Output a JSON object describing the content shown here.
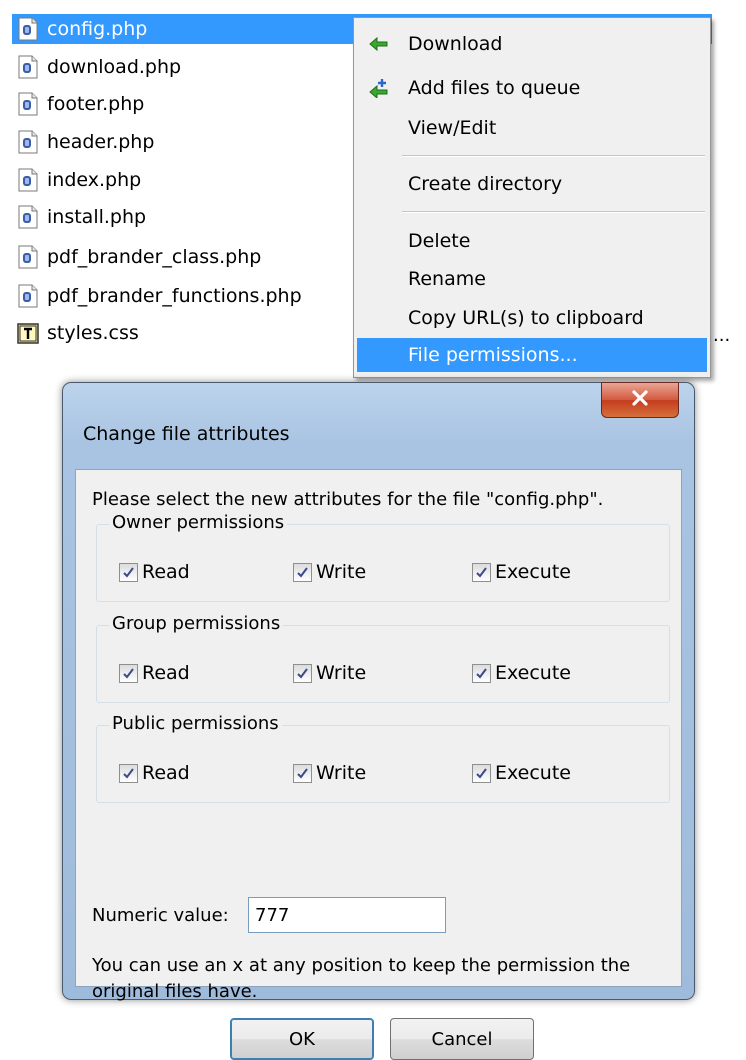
{
  "files": [
    {
      "name": "config.php",
      "icon": "php-file-icon",
      "selected": true
    },
    {
      "name": "download.php",
      "icon": "php-file-icon",
      "selected": false
    },
    {
      "name": "footer.php",
      "icon": "php-file-icon",
      "selected": false
    },
    {
      "name": "header.php",
      "icon": "php-file-icon",
      "selected": false
    },
    {
      "name": "index.php",
      "icon": "php-file-icon",
      "selected": false
    },
    {
      "name": "install.php",
      "icon": "php-file-icon",
      "selected": false
    },
    {
      "name": "pdf_brander_class.php",
      "icon": "php-file-icon",
      "selected": false
    },
    {
      "name": "pdf_brander_functions.php",
      "icon": "php-file-icon",
      "selected": false
    },
    {
      "name": "styles.css",
      "icon": "text-file-icon",
      "selected": false
    }
  ],
  "trailing_dots": "...",
  "context_menu": {
    "items": [
      {
        "label": "Download",
        "icon": "download-arrow-icon"
      },
      {
        "label": "Add files to queue",
        "icon": "add-to-queue-icon"
      },
      {
        "label": "View/Edit"
      },
      {
        "label": "Create directory"
      },
      {
        "label": "Delete"
      },
      {
        "label": "Rename"
      },
      {
        "label": "Copy URL(s) to clipboard"
      },
      {
        "label": "File permissions...",
        "highlighted": true
      }
    ]
  },
  "dialog": {
    "title": "Change file attributes",
    "prompt": "Please select the new attributes for the file \"config.php\".",
    "groups": [
      {
        "label": "Owner permissions",
        "read": "Read",
        "write": "Write",
        "execute": "Execute",
        "checked": [
          true,
          true,
          true
        ]
      },
      {
        "label": "Group permissions",
        "read": "Read",
        "write": "Write",
        "execute": "Execute",
        "checked": [
          true,
          true,
          true
        ]
      },
      {
        "label": "Public permissions",
        "read": "Read",
        "write": "Write",
        "execute": "Execute",
        "checked": [
          true,
          true,
          true
        ]
      }
    ],
    "numeric_label": "Numeric value:",
    "numeric_value": "777",
    "hint": "You can use an x at any position to keep the permission the original files have.",
    "ok_label": "OK",
    "cancel_label": "Cancel"
  },
  "colors": {
    "selection": "#3399ff",
    "menu_bg": "#f0f0f0",
    "close_button": "#c43c1f"
  }
}
